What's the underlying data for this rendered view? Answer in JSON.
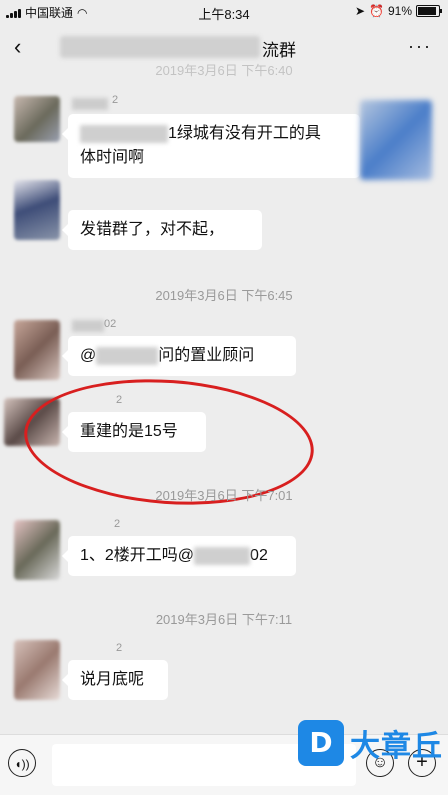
{
  "status_bar": {
    "carrier": "中国联通",
    "time": "上午8:34",
    "battery": "91%",
    "battery_level": 0.91
  },
  "nav": {
    "back_icon": "‹",
    "title_suffix": "流群",
    "more_icon": "···"
  },
  "timestamps": {
    "top_partial": "2019年3月6日 下午6:40",
    "t1": "2019年3月6日 下午6:45",
    "t2": "2019年3月6日 下午7:01",
    "t3": "2019年3月6日 下午7:11"
  },
  "messages": [
    {
      "nick_suffix": "2",
      "text": "1绿城有没有开工的具",
      "text2": "体时间啊"
    },
    {
      "text": "发错群了，对不起，"
    },
    {
      "nick_suffix": "02",
      "text_prefix": "@",
      "text": "问的置业顾问"
    },
    {
      "nick_suffix": "2",
      "text": "重建的是15号"
    },
    {
      "nick_suffix": "2",
      "text": "1、2楼开工吗@",
      "text_suffix": "02"
    },
    {
      "nick_suffix": "2",
      "text": "说月底呢"
    }
  ],
  "input_bar": {
    "voice_icon": "voice-icon",
    "emoji_icon": "emoji-icon",
    "plus_icon": "plus-icon"
  },
  "watermark": {
    "logo_letter": "D",
    "text": "大章丘"
  },
  "colors": {
    "bg": "#ededed",
    "annotation_red": "#d81f1f",
    "watermark_blue": "#1e88e5"
  }
}
